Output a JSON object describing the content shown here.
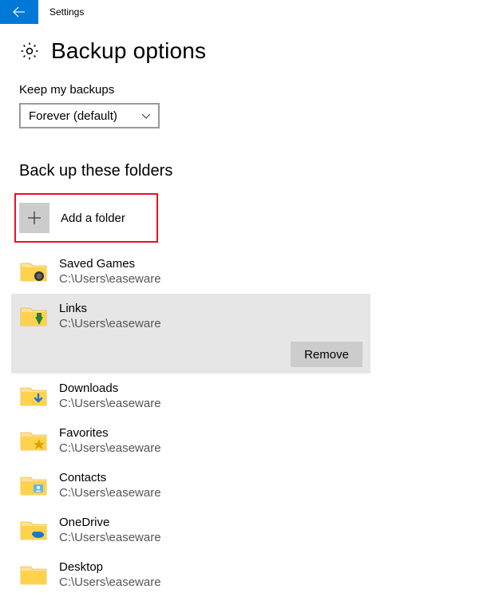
{
  "titlebar": {
    "title": "Settings"
  },
  "header": {
    "title": "Backup options"
  },
  "keep": {
    "label": "Keep my backups",
    "value": "Forever (default)"
  },
  "folders": {
    "title": "Back up these folders",
    "add_label": "Add a folder",
    "remove_label": "Remove",
    "items": [
      {
        "name": "Saved Games",
        "path": "C:\\Users\\easeware"
      },
      {
        "name": "Links",
        "path": "C:\\Users\\easeware"
      },
      {
        "name": "Downloads",
        "path": "C:\\Users\\easeware"
      },
      {
        "name": "Favorites",
        "path": "C:\\Users\\easeware"
      },
      {
        "name": "Contacts",
        "path": "C:\\Users\\easeware"
      },
      {
        "name": "OneDrive",
        "path": "C:\\Users\\easeware"
      },
      {
        "name": "Desktop",
        "path": "C:\\Users\\easeware"
      }
    ]
  }
}
